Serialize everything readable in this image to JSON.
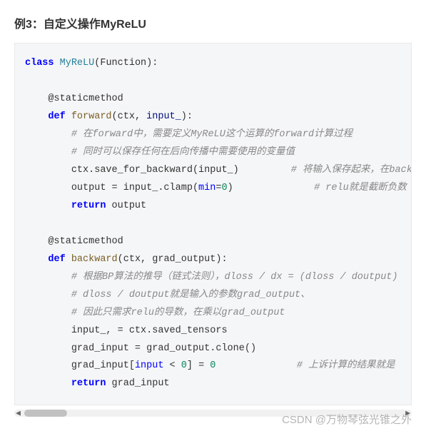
{
  "heading": "例3：自定义操作MyReLU",
  "code": {
    "l1_kw_class": "class",
    "l1_cls": "MyReLU",
    "l1_paren_open": "(",
    "l1_base": "Function",
    "l1_paren_close": "):",
    "l3_deco": "@staticmethod",
    "l4_kw_def": "def",
    "l4_fn": "forward",
    "l4_sig_open": "(ctx, ",
    "l4_param": "input_",
    "l4_sig_close": "):",
    "l5_cmt": "# 在forward中，需要定义MyReLU这个运算的forward计算过程",
    "l6_cmt": "# 同时可以保存任何在后向传播中需要使用的变量值",
    "l7_txt": "ctx.save_for_backward(input_)",
    "l7_cmt": "# 将输入保存起来，在back",
    "l8_txt_a": "output = input_.clamp(",
    "l8_min": "min",
    "l8_eq": "=",
    "l8_zero": "0",
    "l8_txt_b": ")",
    "l8_cmt": "# relu就是截断负数",
    "l9_kw_return": "return",
    "l9_txt": " output",
    "l11_deco": "@staticmethod",
    "l12_kw_def": "def",
    "l12_fn": "backward",
    "l12_sig": "(ctx, grad_output):",
    "l13_cmt": "# 根据BP算法的推导（链式法则），dloss / dx = (dloss / doutput)",
    "l14_cmt": "# dloss / doutput就是输入的参数grad_output、",
    "l15_cmt": "# 因此只需求relu的导数，在乘以grad_output",
    "l16_txt": "input_, = ctx.saved_tensors",
    "l17_txt": "grad_input = grad_output.clone()",
    "l18_txt_a": "grad_input[",
    "l18_input": "input",
    "l18_txt_b": " < ",
    "l18_zero": "0",
    "l18_txt_c": "] = ",
    "l18_zero2": "0",
    "l18_cmt": "# 上诉计算的结果就是",
    "l19_kw_return": "return",
    "l19_txt": " grad_input"
  },
  "watermark": "CSDN @万物琴弦光锥之外"
}
